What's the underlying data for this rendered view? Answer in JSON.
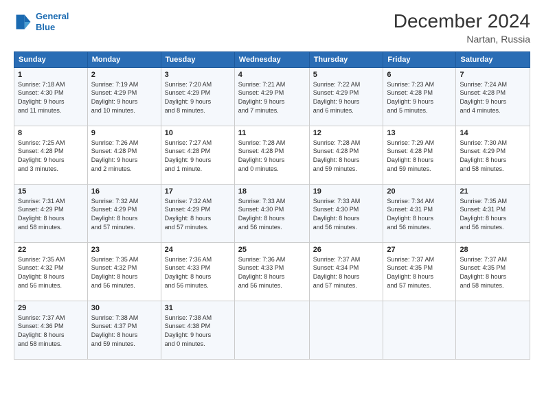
{
  "logo": {
    "line1": "General",
    "line2": "Blue"
  },
  "title": "December 2024",
  "subtitle": "Nartan, Russia",
  "days_of_week": [
    "Sunday",
    "Monday",
    "Tuesday",
    "Wednesday",
    "Thursday",
    "Friday",
    "Saturday"
  ],
  "weeks": [
    [
      {
        "day": "1",
        "info": "Sunrise: 7:18 AM\nSunset: 4:30 PM\nDaylight: 9 hours\nand 11 minutes."
      },
      {
        "day": "2",
        "info": "Sunrise: 7:19 AM\nSunset: 4:29 PM\nDaylight: 9 hours\nand 10 minutes."
      },
      {
        "day": "3",
        "info": "Sunrise: 7:20 AM\nSunset: 4:29 PM\nDaylight: 9 hours\nand 8 minutes."
      },
      {
        "day": "4",
        "info": "Sunrise: 7:21 AM\nSunset: 4:29 PM\nDaylight: 9 hours\nand 7 minutes."
      },
      {
        "day": "5",
        "info": "Sunrise: 7:22 AM\nSunset: 4:29 PM\nDaylight: 9 hours\nand 6 minutes."
      },
      {
        "day": "6",
        "info": "Sunrise: 7:23 AM\nSunset: 4:28 PM\nDaylight: 9 hours\nand 5 minutes."
      },
      {
        "day": "7",
        "info": "Sunrise: 7:24 AM\nSunset: 4:28 PM\nDaylight: 9 hours\nand 4 minutes."
      }
    ],
    [
      {
        "day": "8",
        "info": "Sunrise: 7:25 AM\nSunset: 4:28 PM\nDaylight: 9 hours\nand 3 minutes."
      },
      {
        "day": "9",
        "info": "Sunrise: 7:26 AM\nSunset: 4:28 PM\nDaylight: 9 hours\nand 2 minutes."
      },
      {
        "day": "10",
        "info": "Sunrise: 7:27 AM\nSunset: 4:28 PM\nDaylight: 9 hours\nand 1 minute."
      },
      {
        "day": "11",
        "info": "Sunrise: 7:28 AM\nSunset: 4:28 PM\nDaylight: 9 hours\nand 0 minutes."
      },
      {
        "day": "12",
        "info": "Sunrise: 7:28 AM\nSunset: 4:28 PM\nDaylight: 8 hours\nand 59 minutes."
      },
      {
        "day": "13",
        "info": "Sunrise: 7:29 AM\nSunset: 4:28 PM\nDaylight: 8 hours\nand 59 minutes."
      },
      {
        "day": "14",
        "info": "Sunrise: 7:30 AM\nSunset: 4:29 PM\nDaylight: 8 hours\nand 58 minutes."
      }
    ],
    [
      {
        "day": "15",
        "info": "Sunrise: 7:31 AM\nSunset: 4:29 PM\nDaylight: 8 hours\nand 58 minutes."
      },
      {
        "day": "16",
        "info": "Sunrise: 7:32 AM\nSunset: 4:29 PM\nDaylight: 8 hours\nand 57 minutes."
      },
      {
        "day": "17",
        "info": "Sunrise: 7:32 AM\nSunset: 4:29 PM\nDaylight: 8 hours\nand 57 minutes."
      },
      {
        "day": "18",
        "info": "Sunrise: 7:33 AM\nSunset: 4:30 PM\nDaylight: 8 hours\nand 56 minutes."
      },
      {
        "day": "19",
        "info": "Sunrise: 7:33 AM\nSunset: 4:30 PM\nDaylight: 8 hours\nand 56 minutes."
      },
      {
        "day": "20",
        "info": "Sunrise: 7:34 AM\nSunset: 4:31 PM\nDaylight: 8 hours\nand 56 minutes."
      },
      {
        "day": "21",
        "info": "Sunrise: 7:35 AM\nSunset: 4:31 PM\nDaylight: 8 hours\nand 56 minutes."
      }
    ],
    [
      {
        "day": "22",
        "info": "Sunrise: 7:35 AM\nSunset: 4:32 PM\nDaylight: 8 hours\nand 56 minutes."
      },
      {
        "day": "23",
        "info": "Sunrise: 7:35 AM\nSunset: 4:32 PM\nDaylight: 8 hours\nand 56 minutes."
      },
      {
        "day": "24",
        "info": "Sunrise: 7:36 AM\nSunset: 4:33 PM\nDaylight: 8 hours\nand 56 minutes."
      },
      {
        "day": "25",
        "info": "Sunrise: 7:36 AM\nSunset: 4:33 PM\nDaylight: 8 hours\nand 56 minutes."
      },
      {
        "day": "26",
        "info": "Sunrise: 7:37 AM\nSunset: 4:34 PM\nDaylight: 8 hours\nand 57 minutes."
      },
      {
        "day": "27",
        "info": "Sunrise: 7:37 AM\nSunset: 4:35 PM\nDaylight: 8 hours\nand 57 minutes."
      },
      {
        "day": "28",
        "info": "Sunrise: 7:37 AM\nSunset: 4:35 PM\nDaylight: 8 hours\nand 58 minutes."
      }
    ],
    [
      {
        "day": "29",
        "info": "Sunrise: 7:37 AM\nSunset: 4:36 PM\nDaylight: 8 hours\nand 58 minutes."
      },
      {
        "day": "30",
        "info": "Sunrise: 7:38 AM\nSunset: 4:37 PM\nDaylight: 8 hours\nand 59 minutes."
      },
      {
        "day": "31",
        "info": "Sunrise: 7:38 AM\nSunset: 4:38 PM\nDaylight: 9 hours\nand 0 minutes."
      },
      {
        "day": "",
        "info": ""
      },
      {
        "day": "",
        "info": ""
      },
      {
        "day": "",
        "info": ""
      },
      {
        "day": "",
        "info": ""
      }
    ]
  ]
}
